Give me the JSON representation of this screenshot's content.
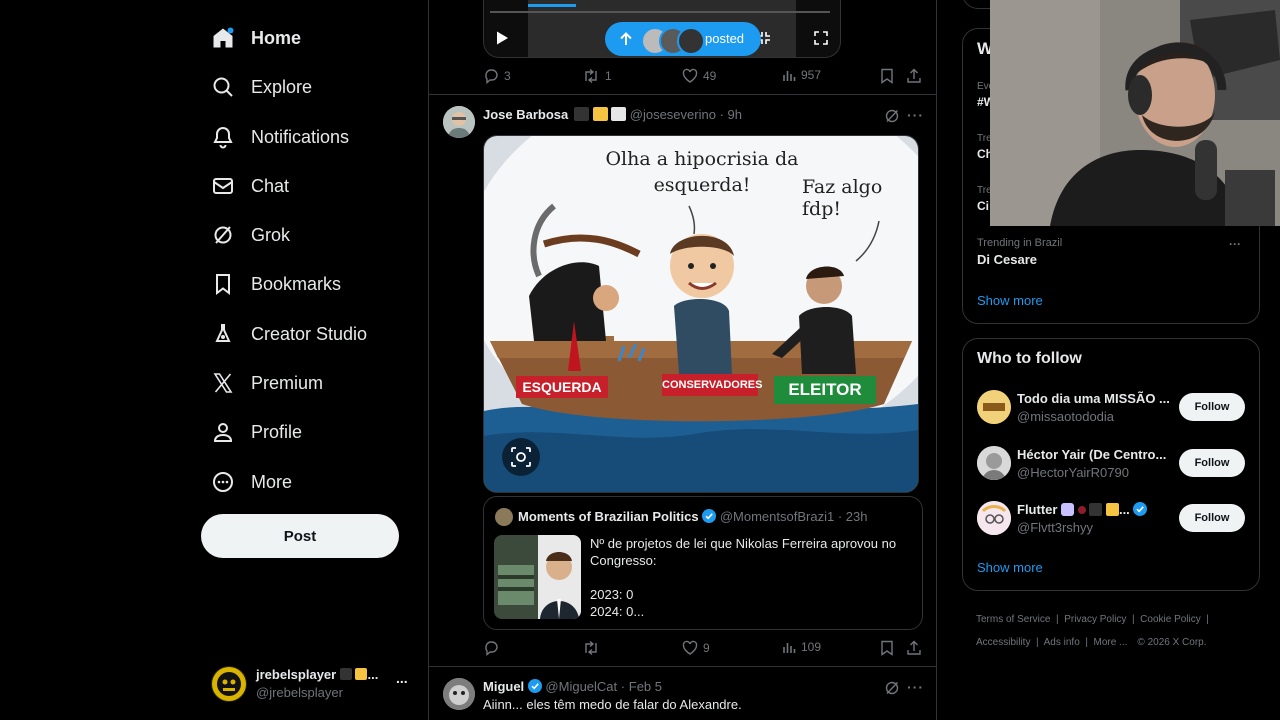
{
  "nav": {
    "items": [
      {
        "label": "Home",
        "icon": "home-icon"
      },
      {
        "label": "Explore",
        "icon": "search-icon"
      },
      {
        "label": "Notifications",
        "icon": "bell-icon"
      },
      {
        "label": "Chat",
        "icon": "mail-icon"
      },
      {
        "label": "Grok",
        "icon": "grok-icon"
      },
      {
        "label": "Bookmarks",
        "icon": "bookmark-icon"
      },
      {
        "label": "Creator Studio",
        "icon": "flask-icon"
      },
      {
        "label": "Premium",
        "icon": "x-logo-icon"
      },
      {
        "label": "Profile",
        "icon": "person-icon"
      },
      {
        "label": "More",
        "icon": "more-circle-icon"
      }
    ],
    "post_label": "Post"
  },
  "account": {
    "name": "jrebelsplayer",
    "handle": "@jrebelsplayer",
    "more": "..."
  },
  "feed": {
    "video_pill": "posted",
    "prev_actions": {
      "replies": "3",
      "reposts": "1",
      "likes": "49",
      "views": "957"
    },
    "tweet1": {
      "name": "Jose Barbosa",
      "handle": "@joseseverino",
      "time": "9h",
      "meme": {
        "caption_left": "Olha a hipocrisia da esquerda!",
        "caption_right": "Faz algo fdp!",
        "label_left": "ESQUERDA",
        "label_mid": "CONSERVADORES",
        "label_right": "ELEITOR"
      },
      "quote": {
        "name": "Moments of Brazilian Politics",
        "handle": "@MomentsofBrazi1",
        "time": "23h",
        "text_line1": "Nº de projetos de lei que Nikolas Ferreira aprovou no",
        "text_line2": "Congresso:",
        "text_line3": "2023: 0",
        "text_line4": "2024: 0..."
      },
      "actions": {
        "replies": "",
        "reposts": "",
        "likes": "9",
        "views": "109"
      }
    },
    "tweet2": {
      "name": "Miguel",
      "handle": "@MiguelCat",
      "time": "Feb 5",
      "text": "Aiinn... eles têm medo de falar do Alexandre."
    }
  },
  "trends": {
    "items": [
      {
        "context": "Eve",
        "title": "#W"
      },
      {
        "context": "Tren",
        "title": "Ch"
      },
      {
        "context": "Tren",
        "title": "Ci"
      },
      {
        "context": "Trending in Brazil",
        "title": "Di Cesare"
      }
    ],
    "show_more": "Show more",
    "header_partial": "W"
  },
  "who_to_follow": {
    "title": "Who to follow",
    "users": [
      {
        "name": "Todo dia uma MISSÃO ...",
        "handle": "@missaotododia",
        "button": "Follow"
      },
      {
        "name": "Héctor Yair (De Centro...",
        "handle": "@HectorYairR0790",
        "button": "Follow"
      },
      {
        "name": "Flutter",
        "handle": "@Flvtt3rshyy",
        "button": "Follow"
      }
    ],
    "show_more": "Show more"
  },
  "footer": {
    "links": [
      "Terms of Service",
      "Privacy Policy",
      "Cookie Policy",
      "Accessibility",
      "Ads info",
      "More ...",
      "© 2026 X Corp."
    ]
  },
  "colors": {
    "accent": "#1d9bf0",
    "bg": "#000000",
    "border": "#2f3336",
    "muted": "#71767b"
  }
}
